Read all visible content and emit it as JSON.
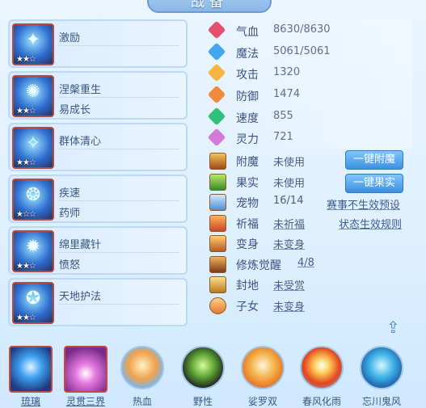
{
  "title": "战备",
  "skills": [
    {
      "name": "激励",
      "sub": "",
      "stars": "★★☆",
      "glyph": "✦"
    },
    {
      "name": "涅槃重生",
      "sub": "易成长",
      "stars": "★★☆",
      "glyph": "✺"
    },
    {
      "name": "群体清心",
      "sub": "",
      "stars": "★★☆",
      "glyph": "✧"
    },
    {
      "name": "疾速",
      "sub": "药师",
      "stars": "★☆☆",
      "glyph": "❂"
    },
    {
      "name": "绵里藏针",
      "sub": "愤怒",
      "stars": "★★☆",
      "glyph": "✹"
    },
    {
      "name": "天地护法",
      "sub": "",
      "stars": "★★☆",
      "glyph": "✪"
    }
  ],
  "stats": [
    {
      "label": "气血",
      "value": "8630/8630",
      "color": "#e5506a"
    },
    {
      "label": "魔法",
      "value": "5061/5061",
      "color": "#3fa6ef"
    },
    {
      "label": "攻击",
      "value": "1320",
      "color": "#f5b540"
    },
    {
      "label": "防御",
      "value": "1474",
      "color": "#f08a3a"
    },
    {
      "label": "速度",
      "value": "855",
      "color": "#31c07a"
    },
    {
      "label": "灵力",
      "value": "721",
      "color": "#d47ad6"
    }
  ],
  "equips": [
    {
      "label": "附魔",
      "value": "未使用"
    },
    {
      "label": "果实",
      "value": "未使用"
    },
    {
      "label": "宠物",
      "value": "16/14"
    },
    {
      "label": "祈福",
      "value": "未祈福"
    },
    {
      "label": "变身",
      "value": "未变身"
    },
    {
      "label": "修炼觉醒",
      "value": "4/8"
    },
    {
      "label": "封地",
      "value": "未受赏"
    },
    {
      "label": "子女",
      "value": "未变身"
    }
  ],
  "buttons": {
    "enchant": "一键附魔",
    "fruit": "一键果实"
  },
  "links": {
    "preset": "赛事不生效预设",
    "rules": "状态生效规则"
  },
  "bottom": [
    {
      "name": "琉璃"
    },
    {
      "name": "灵贯三界"
    },
    {
      "name": "热血"
    },
    {
      "name": "野性"
    },
    {
      "name": "娑罗双"
    },
    {
      "name": "春风化雨"
    },
    {
      "name": "忘川鬼风"
    }
  ]
}
